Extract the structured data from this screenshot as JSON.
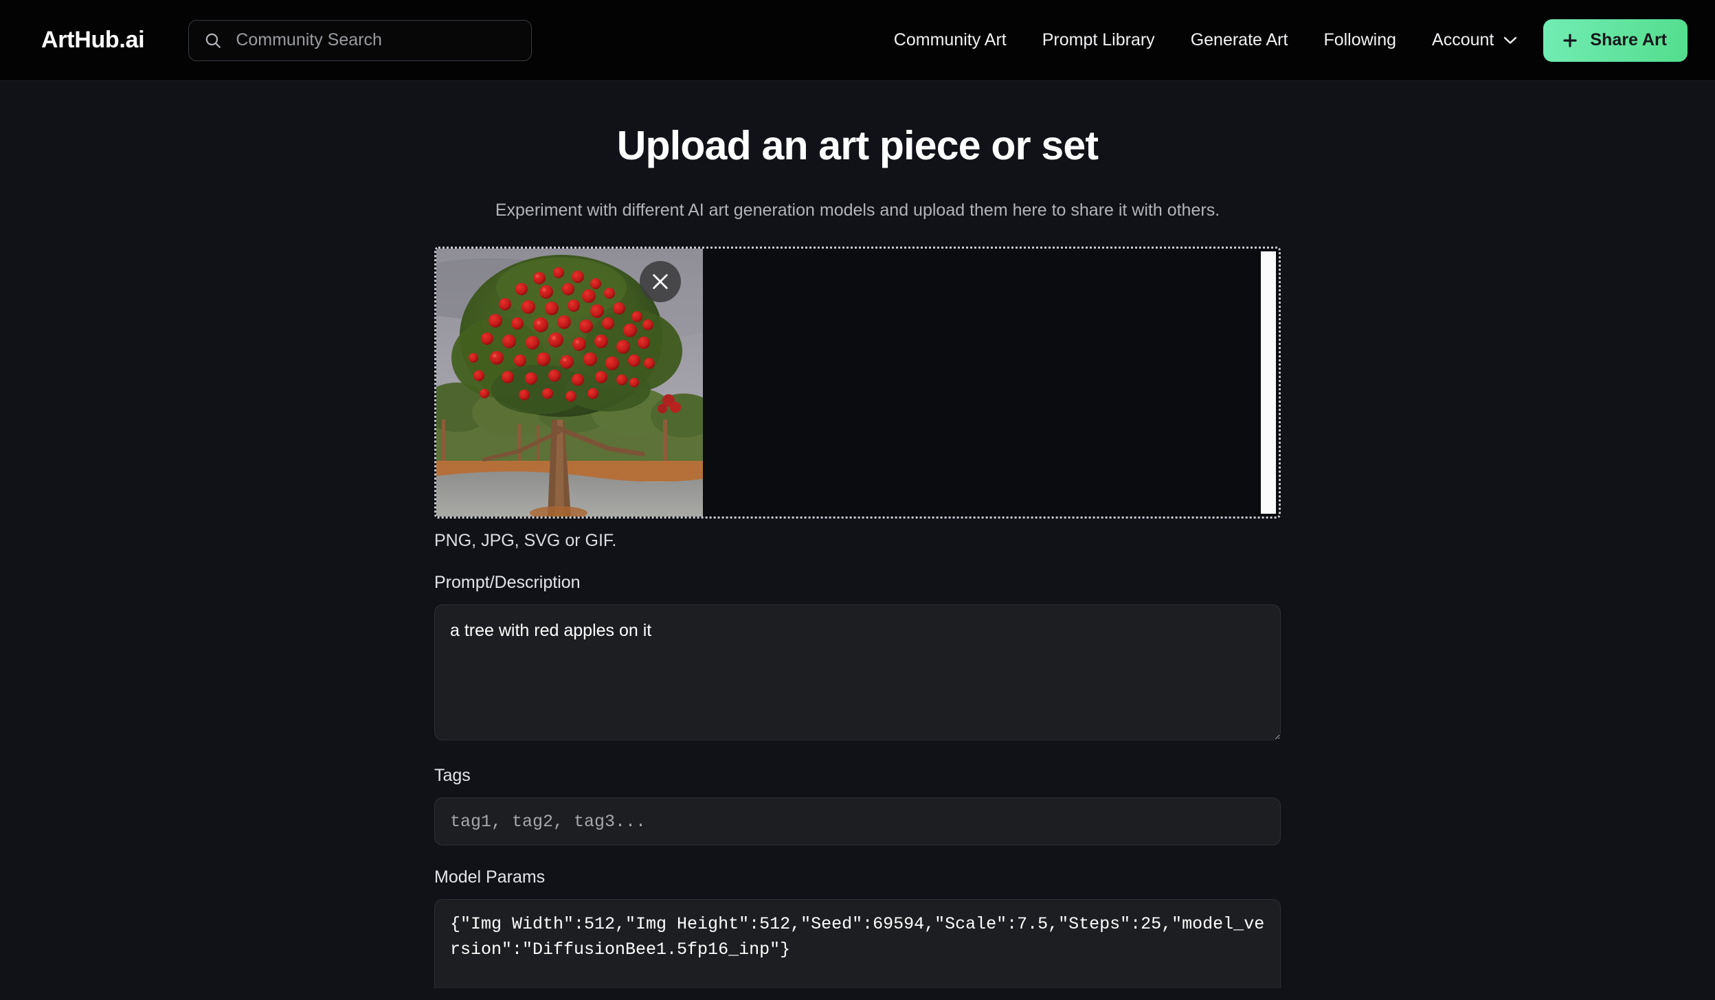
{
  "header": {
    "brand": "ArtHub.ai",
    "search": {
      "placeholder": "Community Search",
      "value": "",
      "icon": "search-icon"
    },
    "nav_links": [
      {
        "label": "Community Art"
      },
      {
        "label": "Prompt Library"
      },
      {
        "label": "Generate Art"
      },
      {
        "label": "Following"
      }
    ],
    "account": {
      "label": "Account",
      "chevron_icon": "chevron-down-icon"
    },
    "share_button": {
      "label": "Share Art",
      "icon": "plus-icon"
    },
    "colors": {
      "bar_background": "#030304",
      "share_gradient_from": "#72ecb4",
      "share_gradient_to": "#53dd8d",
      "share_text": "#15171b"
    }
  },
  "main": {
    "title": "Upload an art piece or set",
    "subtitle": "Experiment with different AI art generation models and upload them here to share it with others.",
    "dropzone": {
      "remove_icon": "close-icon",
      "uploaded_image_alt": "a tree with red apples on it",
      "scrollbar": "dropzone-scrollbar"
    },
    "file_hint": "PNG, JPG, SVG or GIF.",
    "fields": [
      {
        "id": "prompt",
        "label": "Prompt/Description",
        "value": "a tree with red apples on it",
        "placeholder": ""
      },
      {
        "id": "tags",
        "label": "Tags",
        "value": "",
        "placeholder": "tag1, tag2, tag3..."
      },
      {
        "id": "model_params",
        "label": "Model Params",
        "value": "{\"Img Width\":512,\"Img Height\":512,\"Seed\":69594,\"Scale\":7.5,\"Steps\":25,\"model_version\":\"DiffusionBee1.5fp16_inp\"}",
        "placeholder": ""
      }
    ]
  },
  "colors": {
    "page_background": "#101217",
    "field_background": "#1d1e21",
    "muted_text": "#b2b4ba",
    "dropzone_border": "#c9cbd2"
  }
}
